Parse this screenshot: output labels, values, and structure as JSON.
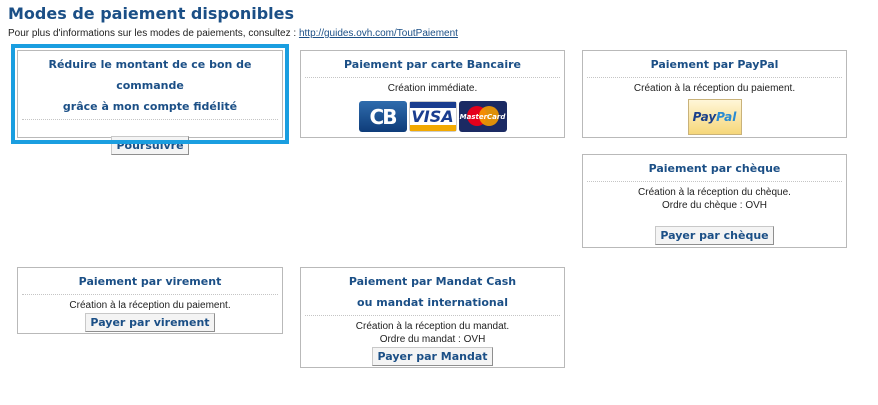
{
  "page": {
    "title": "Modes de paiement disponibles",
    "info_text": "Pour plus d'informations sur les modes de paiements, consultez : ",
    "info_link": "http://guides.ovh.com/ToutPaiement"
  },
  "boxes": {
    "fidelite": {
      "title_line1": "Réduire le montant de ce bon de commande",
      "title_line2": "grâce à mon compte fidélité",
      "button": "Poursuivre"
    },
    "carte": {
      "title": "Paiement par carte Bancaire",
      "desc": "Création immédiate.",
      "logos": [
        "CB",
        "VISA",
        "MasterCard"
      ]
    },
    "paypal": {
      "title": "Paiement par PayPal",
      "desc": "Création à la réception du paiement.",
      "logo_part1": "Pay",
      "logo_part2": "Pal"
    },
    "cheque": {
      "title": "Paiement par chèque",
      "desc_line1": "Création à la réception du chèque.",
      "desc_line2": "Ordre du chèque : OVH",
      "button": "Payer par chèque"
    },
    "virement": {
      "title": "Paiement par virement",
      "desc": "Création à la réception du paiement.",
      "button": "Payer par virement"
    },
    "mandat": {
      "title_line1": "Paiement par Mandat Cash",
      "title_line2": "ou mandat international",
      "desc_line1": "Création à la réception du mandat.",
      "desc_line2": "Ordre du mandat : OVH",
      "button": "Payer par Mandat"
    }
  },
  "colors": {
    "accent": "#1b4f86",
    "highlight": "#1a9ee0"
  }
}
